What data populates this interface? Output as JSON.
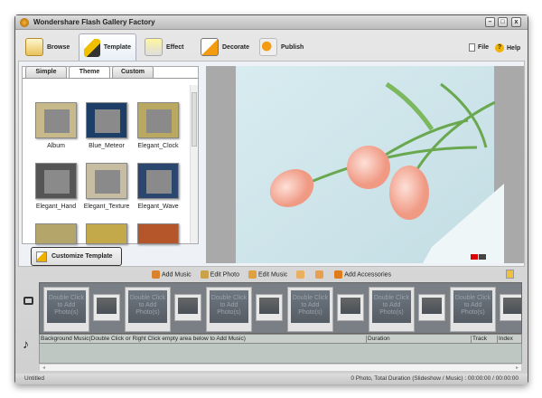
{
  "window": {
    "title": "Wondershare Flash Gallery Factory",
    "min": "–",
    "max": "□",
    "close": "x"
  },
  "toolbar": {
    "items": [
      {
        "label": "Browse"
      },
      {
        "label": "Template"
      },
      {
        "label": "Effect"
      },
      {
        "label": "Decorate"
      },
      {
        "label": "Publish"
      }
    ],
    "file": "File",
    "help": "Help"
  },
  "template_tabs": [
    "Simple",
    "Theme",
    "Custom"
  ],
  "templates": [
    "Album",
    "Blue_Meteor",
    "Elegant_Clock",
    "Elegant_Hand",
    "Elegant_Texture",
    "Elegant_Wave"
  ],
  "customize_label": "Customize Template",
  "actions": {
    "add_music": "Add Music",
    "edit_photo": "Edit Photo",
    "edit_music": "Edit Music",
    "add_accessories": "Add Accessories"
  },
  "storyboard": {
    "slot_text": "Double Click to Add Photo(s)"
  },
  "music": {
    "col_bg": "Background Music(Double Click or Right Click empty area below to Add Music)",
    "col_duration": "Duration",
    "col_track": "Track",
    "col_index": "Index"
  },
  "status": {
    "left": "Untitled",
    "right": "0 Photo, Total Duration (Slideshow / Music) : 00:00:00 / 00:00:00"
  }
}
